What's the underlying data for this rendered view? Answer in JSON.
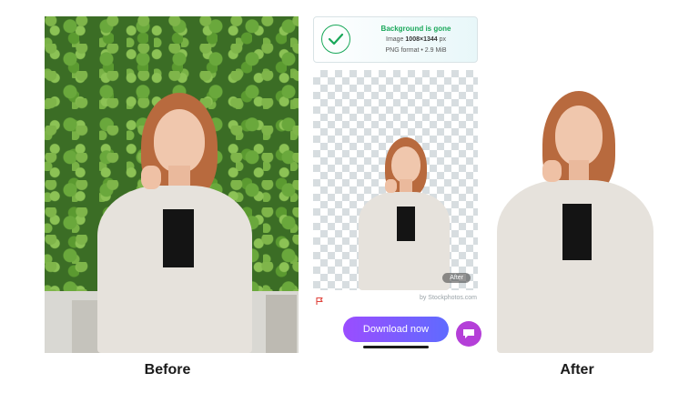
{
  "captions": {
    "before": "Before",
    "after": "After"
  },
  "result_card": {
    "title": "Background is gone",
    "size_prefix": "Image ",
    "size_value": "1008×1344",
    "size_unit": " px",
    "format": "PNG format • 2.9 MiB"
  },
  "preview": {
    "badge": "After"
  },
  "credit": "by Stockphotos.com",
  "download_button": "Download now",
  "icons": {
    "check": "check-icon",
    "flag": "flag-icon",
    "chat": "chat-icon"
  },
  "colors": {
    "success": "#1aa85a",
    "accent_start": "#9b4dff",
    "accent_end": "#5f6bff",
    "chat": "#b43fd8"
  }
}
